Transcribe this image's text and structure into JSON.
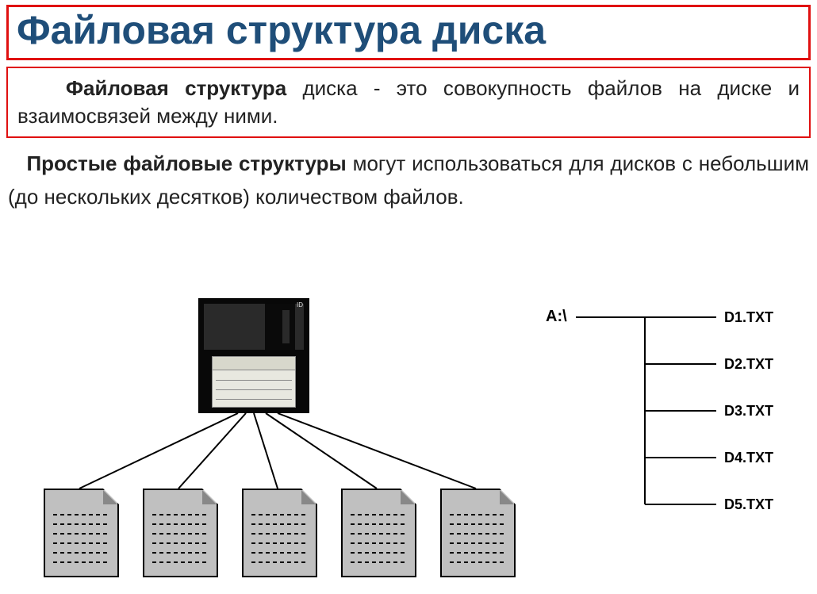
{
  "title": "Файловая структура диска",
  "definition": {
    "bold": "Файловая структура",
    "rest": " диска - это совокупность файлов на диске и взаимосвязей между ними."
  },
  "paragraph": {
    "bold": "Простые файловые структуры",
    "rest": " могут использоваться для дисков с небольшим (до нескольких десятков) количеством файлов."
  },
  "tree": {
    "root": "A:\\",
    "items": [
      "D1.TXT",
      "D2.TXT",
      "D3.TXT",
      "D4.TXT",
      "D5.TXT"
    ]
  }
}
